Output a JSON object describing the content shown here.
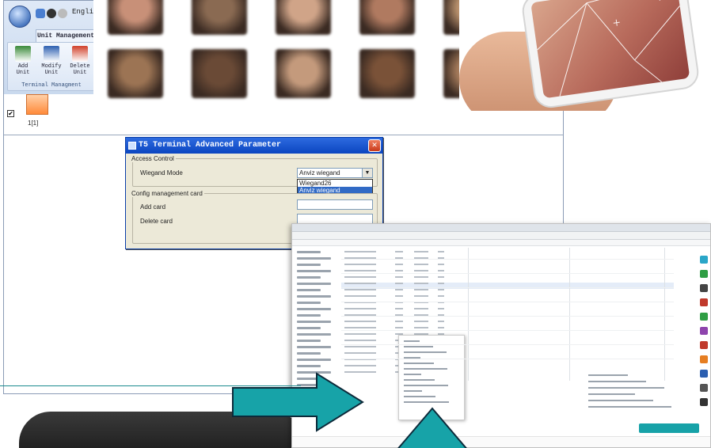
{
  "app": {
    "language_label": "English",
    "ribbon_tab": "Unit Management",
    "ribbon_buttons": [
      {
        "label": "Add\nUnit",
        "icon": "add-unit-icon",
        "color": "#3a8a3a"
      },
      {
        "label": "Modify\nUnit",
        "icon": "modify-unit-icon",
        "color": "#2c5fb0"
      },
      {
        "label": "Delete\nUnit",
        "icon": "delete-unit-icon",
        "color": "#d0402a"
      }
    ],
    "ribbon_group_label": "Terminal Managment",
    "unit": {
      "name": "1[1]",
      "checked": true,
      "check_mark": "✔"
    }
  },
  "dialog": {
    "title": "T5 Terminal Advanced Parameter",
    "close_label": "✕",
    "access_control": {
      "legend": "Access Control",
      "wiegand_label": "Wiegand Mode",
      "wiegand_value": "Anviz wiegand",
      "arrow": "▼",
      "options": [
        "Wiegand26",
        "Anviz wiegand"
      ],
      "selected_index": 1
    },
    "config_card": {
      "legend": "Config management card",
      "add_label": "Add card",
      "delete_label": "Delete card"
    }
  },
  "colors": {
    "accent_teal": "#1a8a8e",
    "arrow_fill": "#17a3a8",
    "title_bar": "#0b45c0"
  },
  "photos": [
    "#c89078",
    "#8a6a52",
    "#d0a488",
    "#b07a60",
    "#b8906c",
    "#c88a72",
    "#9c7454",
    "#6a4a36",
    "#c49a7c",
    "#7a5238",
    "#a47a5a",
    "#8c6a50"
  ]
}
